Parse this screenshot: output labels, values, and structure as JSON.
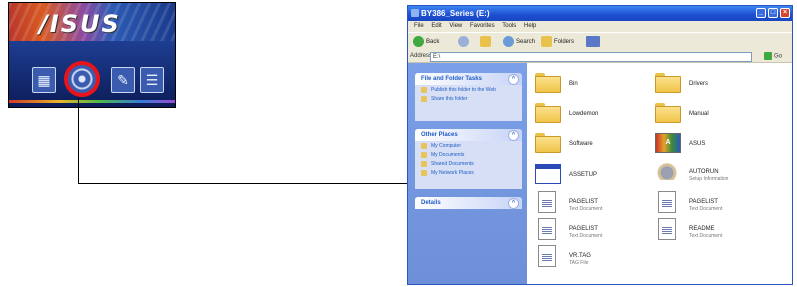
{
  "launcher": {
    "logo": "/ISUS"
  },
  "explorer": {
    "title": "BY386_Series (E:)",
    "menu": [
      "File",
      "Edit",
      "View",
      "Favorites",
      "Tools",
      "Help"
    ],
    "toolbar": {
      "back": "Back",
      "search": "Search",
      "folders": "Folders"
    },
    "address": {
      "label": "Address",
      "value": "E:\\",
      "go": "Go"
    },
    "tasks": {
      "file_folder": {
        "title": "File and Folder Tasks",
        "items": [
          "Publish this folder to the Web",
          "Share this folder"
        ]
      },
      "other_places": {
        "title": "Other Places",
        "items": [
          "My Computer",
          "My Documents",
          "Shared Documents",
          "My Network Places"
        ]
      },
      "details": {
        "title": "Details"
      }
    },
    "files": [
      {
        "name": "Bin",
        "sub": ""
      },
      {
        "name": "Drivers",
        "sub": ""
      },
      {
        "name": "Lowdemon",
        "sub": ""
      },
      {
        "name": "Manual",
        "sub": ""
      },
      {
        "name": "Software",
        "sub": ""
      },
      {
        "name": "ASUS",
        "sub": ""
      },
      {
        "name": "ASSETUP",
        "sub": ""
      },
      {
        "name": "AUTORUN",
        "sub": "Setup Information"
      },
      {
        "name": "PAGELIST",
        "sub": "Text Document"
      },
      {
        "name": "PAGELIST",
        "sub": "Text Document"
      },
      {
        "name": "PAGELIST",
        "sub": "Text Document"
      },
      {
        "name": "README",
        "sub": "Text Document"
      },
      {
        "name": "VR.TAG",
        "sub": "TAG File"
      }
    ]
  }
}
